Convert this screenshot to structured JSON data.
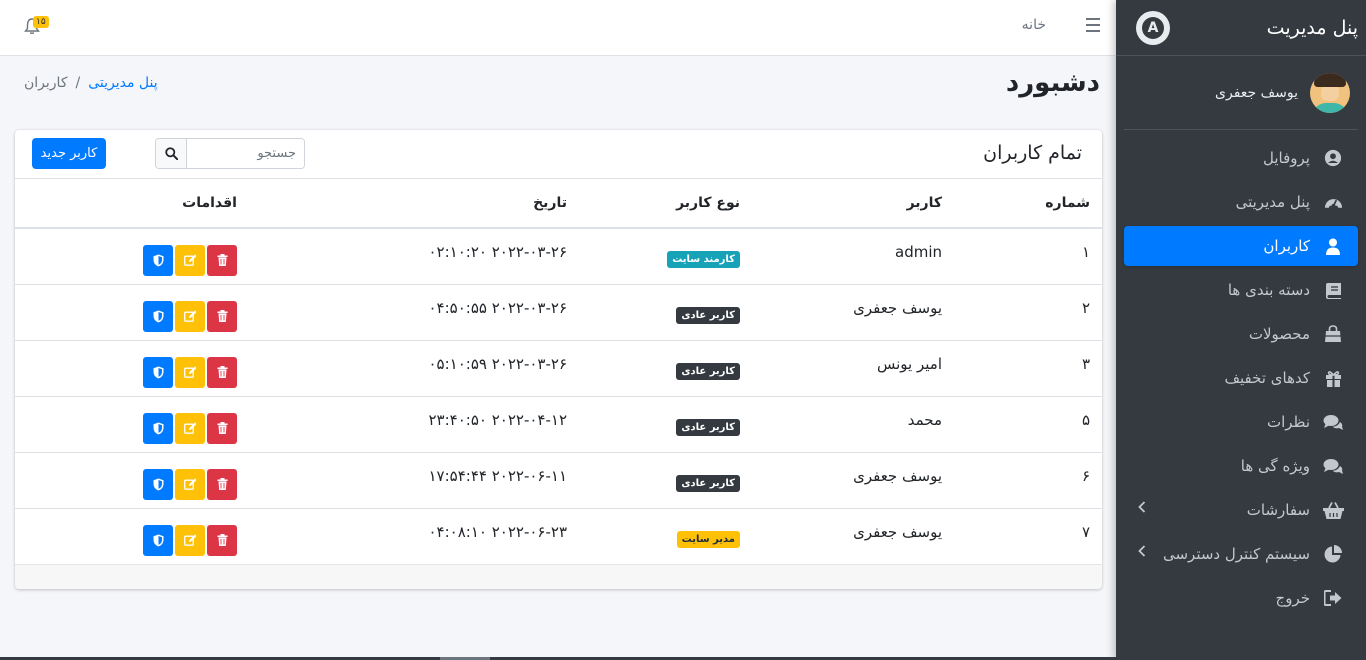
{
  "sidebar": {
    "brand": "پنل مدیریت",
    "user_name": "یوسف جعفری",
    "items": [
      {
        "label": "پروفایل",
        "icon": "user-circle-icon",
        "active": false
      },
      {
        "label": "پنل مدیریتی",
        "icon": "dashboard-gauge-icon",
        "active": false
      },
      {
        "label": "کاربران",
        "icon": "user-icon",
        "active": true
      },
      {
        "label": "دسته بندی ها",
        "icon": "book-icon",
        "active": false
      },
      {
        "label": "محصولات",
        "icon": "shopping-bag-icon",
        "active": false
      },
      {
        "label": "کدهای تخفیف",
        "icon": "gift-icon",
        "active": false
      },
      {
        "label": "نظرات",
        "icon": "comments-icon",
        "active": false
      },
      {
        "label": "ویژه گی ها",
        "icon": "comments-icon",
        "active": false
      },
      {
        "label": "سفارشات",
        "icon": "basket-icon",
        "active": false,
        "has_submenu": true
      },
      {
        "label": "سیستم کنترل دسترسی",
        "icon": "pie-chart-icon",
        "active": false,
        "has_submenu": true
      },
      {
        "label": "خروج",
        "icon": "sign-out-icon",
        "active": false
      }
    ]
  },
  "topbar": {
    "home_label": "خانه",
    "notification_count": "۱۵"
  },
  "content": {
    "page_title": "دشبورد",
    "breadcrumb": {
      "link": "پنل مدیریتی",
      "separator": "/",
      "current": "کاربران"
    }
  },
  "card": {
    "title": "تمام کاربران",
    "search_placeholder": "جستجو",
    "new_user_label": "کاربر جدید",
    "columns": [
      "شماره",
      "کاربر",
      "نوع کاربر",
      "تاریخ",
      "اقدامات"
    ],
    "rows": [
      {
        "num": "۱",
        "user": "admin",
        "role": "کارمند سایت",
        "role_color": "#17a2b8",
        "date": "۲۰۲۲-۰۳-۲۶ ۰۲:۱۰:۲۰"
      },
      {
        "num": "۲",
        "user": "یوسف جعفری",
        "role": "کاربر عادی",
        "role_color": "#343a40",
        "date": "۲۰۲۲-۰۳-۲۶ ۰۴:۵۰:۵۵"
      },
      {
        "num": "۳",
        "user": "امیر یونس",
        "role": "کاربر عادی",
        "role_color": "#343a40",
        "date": "۲۰۲۲-۰۳-۲۶ ۰۵:۱۰:۵۹"
      },
      {
        "num": "۵",
        "user": "محمد",
        "role": "کاربر عادی",
        "role_color": "#343a40",
        "date": "۲۰۲۲-۰۴-۱۲ ۲۳:۴۰:۵۰"
      },
      {
        "num": "۶",
        "user": "یوسف جعفری",
        "role": "کاربر عادی",
        "role_color": "#343a40",
        "date": "۲۰۲۲-۰۶-۱۱ ۱۷:۵۴:۴۴"
      },
      {
        "num": "۷",
        "user": "یوسف جعفری",
        "role": "مدیر سایت",
        "role_color": "#ffc107",
        "date": "۲۰۲۲-۰۶-۲۳ ۰۴:۰۸:۱۰"
      }
    ]
  }
}
